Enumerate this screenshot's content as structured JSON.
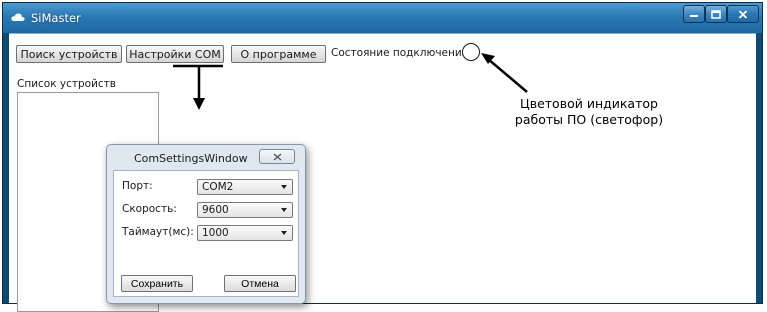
{
  "window": {
    "title": "SiMaster",
    "app_icon": "cloud-icon",
    "controls": {
      "minimize_icon": "minimize-icon",
      "maximize_icon": "maximize-icon",
      "close_icon": "close-icon"
    },
    "colors": {
      "frame": "#0f4a73",
      "titlebar": "#2b78b3"
    }
  },
  "toolbar": {
    "search_label": "Поиск устройств",
    "com_settings_label": "Настройки COM",
    "about_label": "О программе",
    "status_label": "Состояние подключения:"
  },
  "device_list": {
    "label": "Список устройств",
    "items": []
  },
  "annotation": {
    "line1": "Цветовой индикатор",
    "line2": "работы ПО (светофор)"
  },
  "dialog": {
    "title": "ComSettingsWindow",
    "close_icon": "close-icon",
    "fields": {
      "port_label": "Порт:",
      "port_value": "COM2",
      "speed_label": "Скорость:",
      "speed_value": "9600",
      "timeout_label": "Таймаут(мс):",
      "timeout_value": "1000"
    },
    "save_label": "Сохранить",
    "cancel_label": "Отмена"
  }
}
